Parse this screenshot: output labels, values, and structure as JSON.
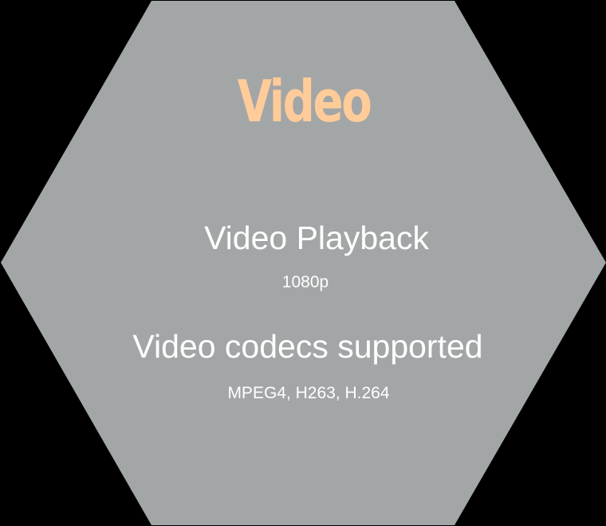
{
  "colors": {
    "background": "#000000",
    "hexagon_fill": "#a3a6a7",
    "heading": "#ffcc99",
    "body_text": "#ffffff"
  },
  "heading": "Video",
  "features": [
    {
      "title": "Video Playback",
      "value": "1080p"
    },
    {
      "title": "Video codecs supported",
      "value": "MPEG4, H263, H.264"
    }
  ]
}
